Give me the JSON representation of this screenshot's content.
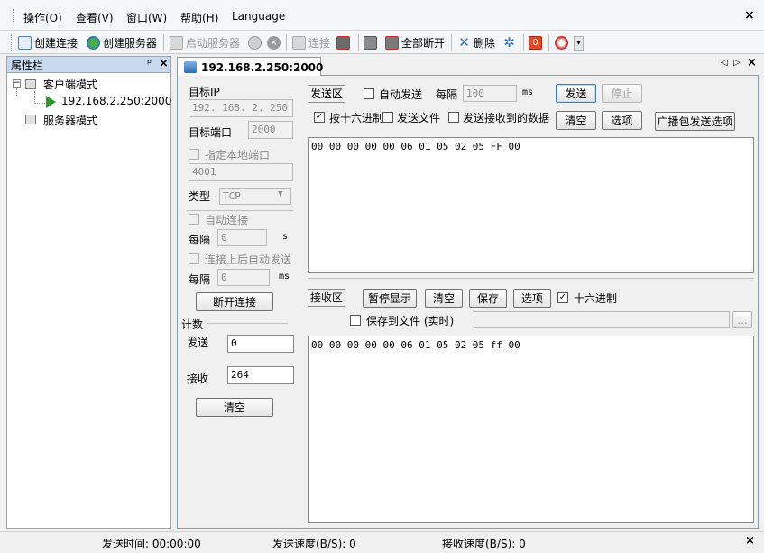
{
  "menu": {
    "items": [
      "操作(O)",
      "查看(V)",
      "窗口(W)",
      "帮助(H)",
      "Language"
    ],
    "close_label": "×"
  },
  "toolbar": {
    "create_connection": "创建连接",
    "create_server": "创建服务器",
    "start_server": "启动服务器",
    "connect": "连接",
    "disconnect_all": "全部断开",
    "delete": "删除"
  },
  "sidebar": {
    "title": "属性栏",
    "pin_label": "ᵖ",
    "close_label": "×",
    "tree": {
      "client_mode": "客户端模式",
      "client_child": "192.168.2.250:2000",
      "server_mode": "服务器模式"
    }
  },
  "tab": {
    "label": "192.168.2.250:2000",
    "nav_left": "◁",
    "nav_right": "▷",
    "close": "×"
  },
  "settings": {
    "target_ip_label": "目标IP",
    "target_ip_value": "192. 168. 2. 250",
    "target_port_label": "目标端口",
    "target_port_value": "2000",
    "local_port_label": "指定本地端口",
    "local_port_value": "4001",
    "type_label": "类型",
    "type_value": "TCP",
    "auto_connect_label": "自动连接",
    "interval_label": "每隔",
    "interval_value": "0",
    "interval_unit": "s",
    "auto_send_label": "连接上后自动发送",
    "interval2_label": "每隔",
    "interval2_value": "0",
    "interval2_unit": "ms",
    "disconnect_button": "断开连接"
  },
  "counter": {
    "title": "计数",
    "send_label": "发送",
    "send_value": "0",
    "recv_label": "接收",
    "recv_value": "264",
    "clear_button": "清空"
  },
  "send_area": {
    "title": "发送区",
    "auto_send_label": "自动发送",
    "interval_label": "每隔",
    "interval_value": "100",
    "interval_unit": "ms",
    "send_button": "发送",
    "stop_button": "停止",
    "hex_label": "按十六进制",
    "file_label": "发送文件",
    "send_received_label": "发送接收到的数据",
    "clear_button": "清空",
    "options_button": "选项",
    "broadcast_button": "广播包发送选项",
    "content": "00 00 00 00 00 06 01 05 02 05 FF 00"
  },
  "recv_area": {
    "title": "接收区",
    "pause_button": "暂停显示",
    "clear_button": "清空",
    "save_button": "保存",
    "options_button": "选项",
    "hex_label": "十六进制",
    "save_file_label": "保存到文件 (实时)",
    "browse_button": "...",
    "content": "00 00 00 00 00 06 01 05 02 05 ff 00"
  },
  "statusbar": {
    "send_time": "发送时间: 00:00:00",
    "send_speed": "发送速度(B/S): 0",
    "recv_speed": "接收速度(B/S): 0",
    "close": "×"
  },
  "colors": {
    "accent": "#3c7fb1",
    "panel_header": "#c9d9ee",
    "play_green": "#2a9a2a"
  }
}
